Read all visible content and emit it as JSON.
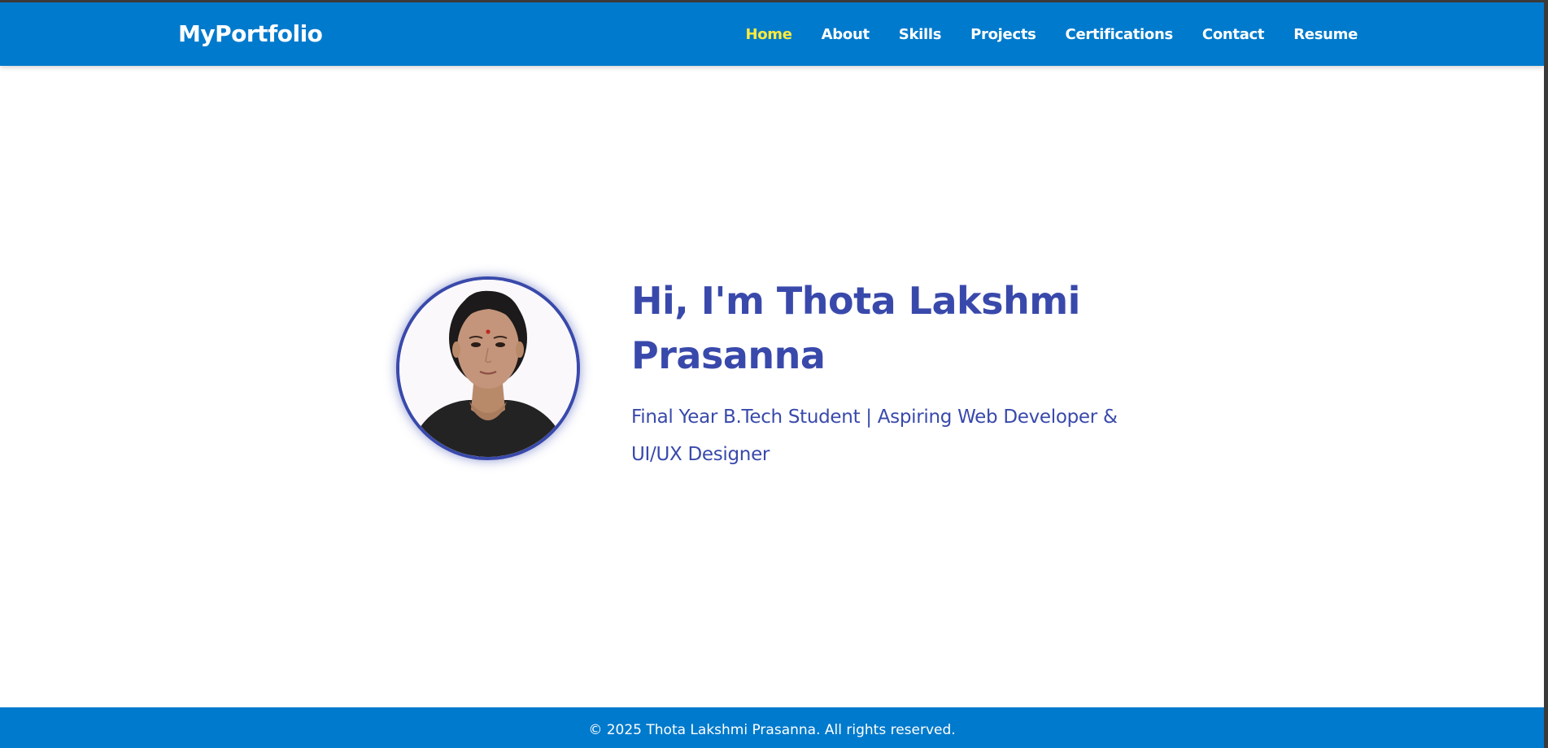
{
  "brand": "MyPortfolio",
  "nav": {
    "items": [
      {
        "label": "Home",
        "active": true
      },
      {
        "label": "About"
      },
      {
        "label": "Skills"
      },
      {
        "label": "Projects"
      },
      {
        "label": "Certifications"
      },
      {
        "label": "Contact"
      },
      {
        "label": "Resume"
      }
    ]
  },
  "hero": {
    "title": "Hi, I'm Thota Lakshmi Prasanna",
    "subtitle": "Final Year B.Tech Student | Aspiring Web Developer & UI/UX Designer"
  },
  "footer": {
    "text": "© 2025 Thota Lakshmi Prasanna. All rights reserved."
  },
  "colors": {
    "navbar": "#007acc",
    "active_link": "#ffeb3b",
    "accent": "#3949ab",
    "background": "#ffffff"
  }
}
